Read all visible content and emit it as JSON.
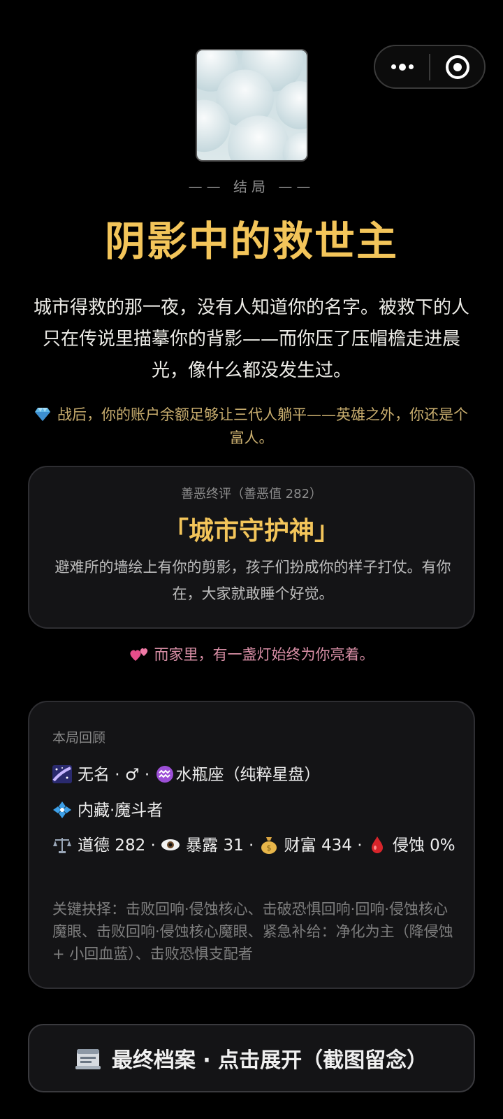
{
  "capsule": {
    "menu_icon": "more-dots-icon",
    "close_icon": "target-close-icon"
  },
  "cover": {
    "icon": "cloud-cover-art"
  },
  "ending": {
    "label": "—— 结局 ——",
    "title": "阴影中的救世主",
    "narrative": "城市得救的那一夜，没有人知道你的名字。被救下的人只在传说里描摹你的背影——而你压了压帽檐走进晨光，像什么都没发生过。",
    "wealth_note": "战后，你的账户余额足够让三代人躺平——英雄之外，你还是个富人。",
    "wealth_icon": "gem-icon"
  },
  "karma": {
    "subtitle": "善恶终评（善恶值 282）",
    "title": "「城市守护神」",
    "description": "避难所的墙绘上有你的剪影，孩子们扮成你的样子打仗。有你在，大家就敢睡个好觉。"
  },
  "home_note": {
    "icon": "two-hearts-icon",
    "text": "而家里，有一盏灯始终为你亮着。"
  },
  "review": {
    "heading": "本局回顾",
    "identity": "无名 · ♂ · ",
    "zodiac_text": "水瓶座（纯粹星盘）",
    "class_text": "内藏·魔斗者",
    "stats": {
      "morality": "道德 282 · ",
      "exposure": "暴露 31 · ",
      "wealth": "财富 434 · ",
      "corruption": "侵蚀 0%"
    },
    "key_choices": "关键抉择：击败回响·侵蚀核心、击破恐惧回响·回响·侵蚀核心魔眼、击败回响·侵蚀核心魔眼、紧急补给：净化为主（降侵蚀 + 小回血蓝）、击败恐惧支配者"
  },
  "archive_button": {
    "icon": "card-file-icon",
    "label": "最终档案 · 点击展开（截图留念）"
  },
  "colors": {
    "accent_gold": "#f3c55a",
    "wealth_gold": "#c8ad6e",
    "home_pink": "#d98fa6",
    "card_bg": "#141416"
  }
}
